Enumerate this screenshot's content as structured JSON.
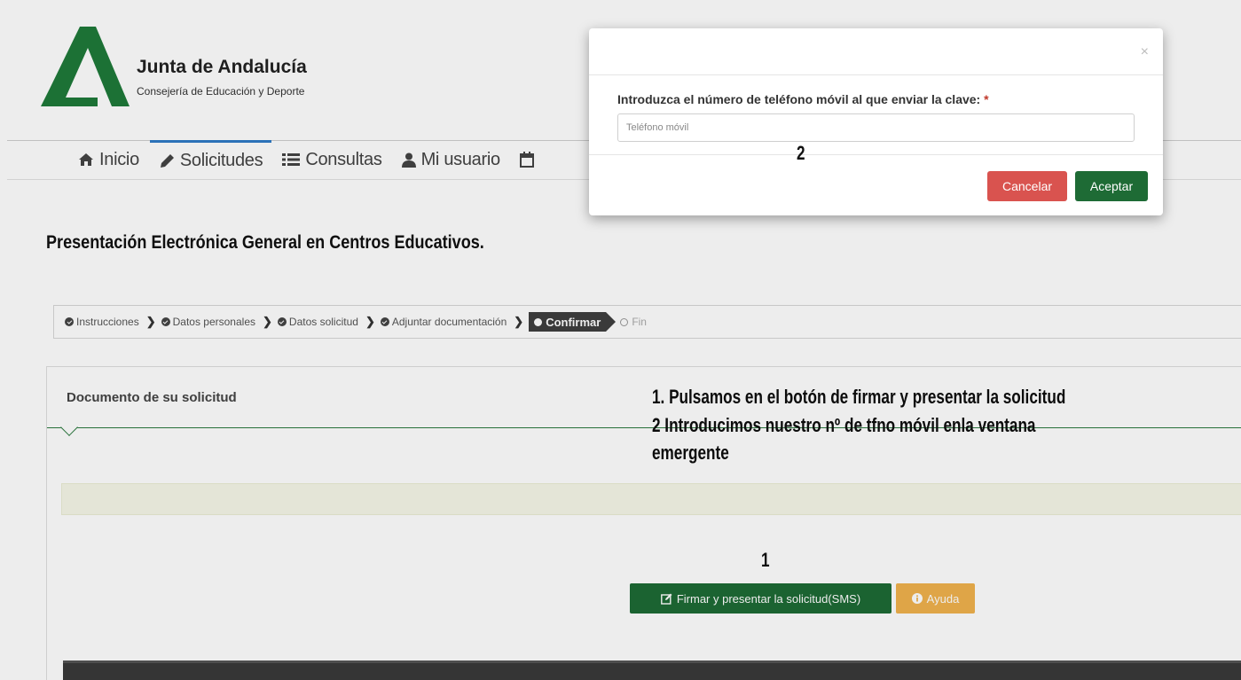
{
  "brand": {
    "title": "Junta de Andalucía",
    "subtitle": "Consejería de Educación y Deporte",
    "logo_icon": "junta-andalucia-logo",
    "logo_color": "#1f7a3a"
  },
  "nav": {
    "items": [
      {
        "label": "Inicio",
        "icon": "home-icon",
        "active": false
      },
      {
        "label": "Solicitudes",
        "icon": "pencil-icon",
        "active": true
      },
      {
        "label": "Consultas",
        "icon": "list-icon",
        "active": false
      },
      {
        "label": "Mi usuario",
        "icon": "user-icon",
        "active": false
      }
    ],
    "partial_icon": "calendar-icon"
  },
  "page": {
    "heading": "Presentación Electrónica General en Centros Educativos."
  },
  "wizard": {
    "steps": [
      {
        "label": "Instrucciones",
        "state": "done"
      },
      {
        "label": "Datos personales",
        "state": "done"
      },
      {
        "label": "Datos solicitud",
        "state": "done"
      },
      {
        "label": "Adjuntar documentación",
        "state": "done"
      },
      {
        "label": "Confirmar",
        "state": "active"
      },
      {
        "label": "Fin",
        "state": "todo"
      }
    ]
  },
  "document": {
    "title": "Documento de su solicitud",
    "sign_button": "Firmar y presentar la solicitud(SMS)",
    "help_button": "Ayuda"
  },
  "annotations": {
    "line1": "1. Pulsamos en el botón de firmar y presentar la solicitud",
    "line2": "2 Introducimos nuestro nº de tfno móvil enla ventana",
    "line3": "emergente",
    "marker1": "1",
    "marker2": "2"
  },
  "modal": {
    "close": "×",
    "label": "Introduzca el número de teléfono móvil al que enviar la clave:",
    "required_mark": "*",
    "phone_placeholder": "Teléfono móvil",
    "phone_value": "",
    "cancel": "Cancelar",
    "accept": "Aceptar"
  },
  "colors": {
    "primary_green": "#1e6b35",
    "danger_red": "#d9534f",
    "warning_orange": "#f0b24d",
    "nav_active": "#2f7bc6"
  }
}
